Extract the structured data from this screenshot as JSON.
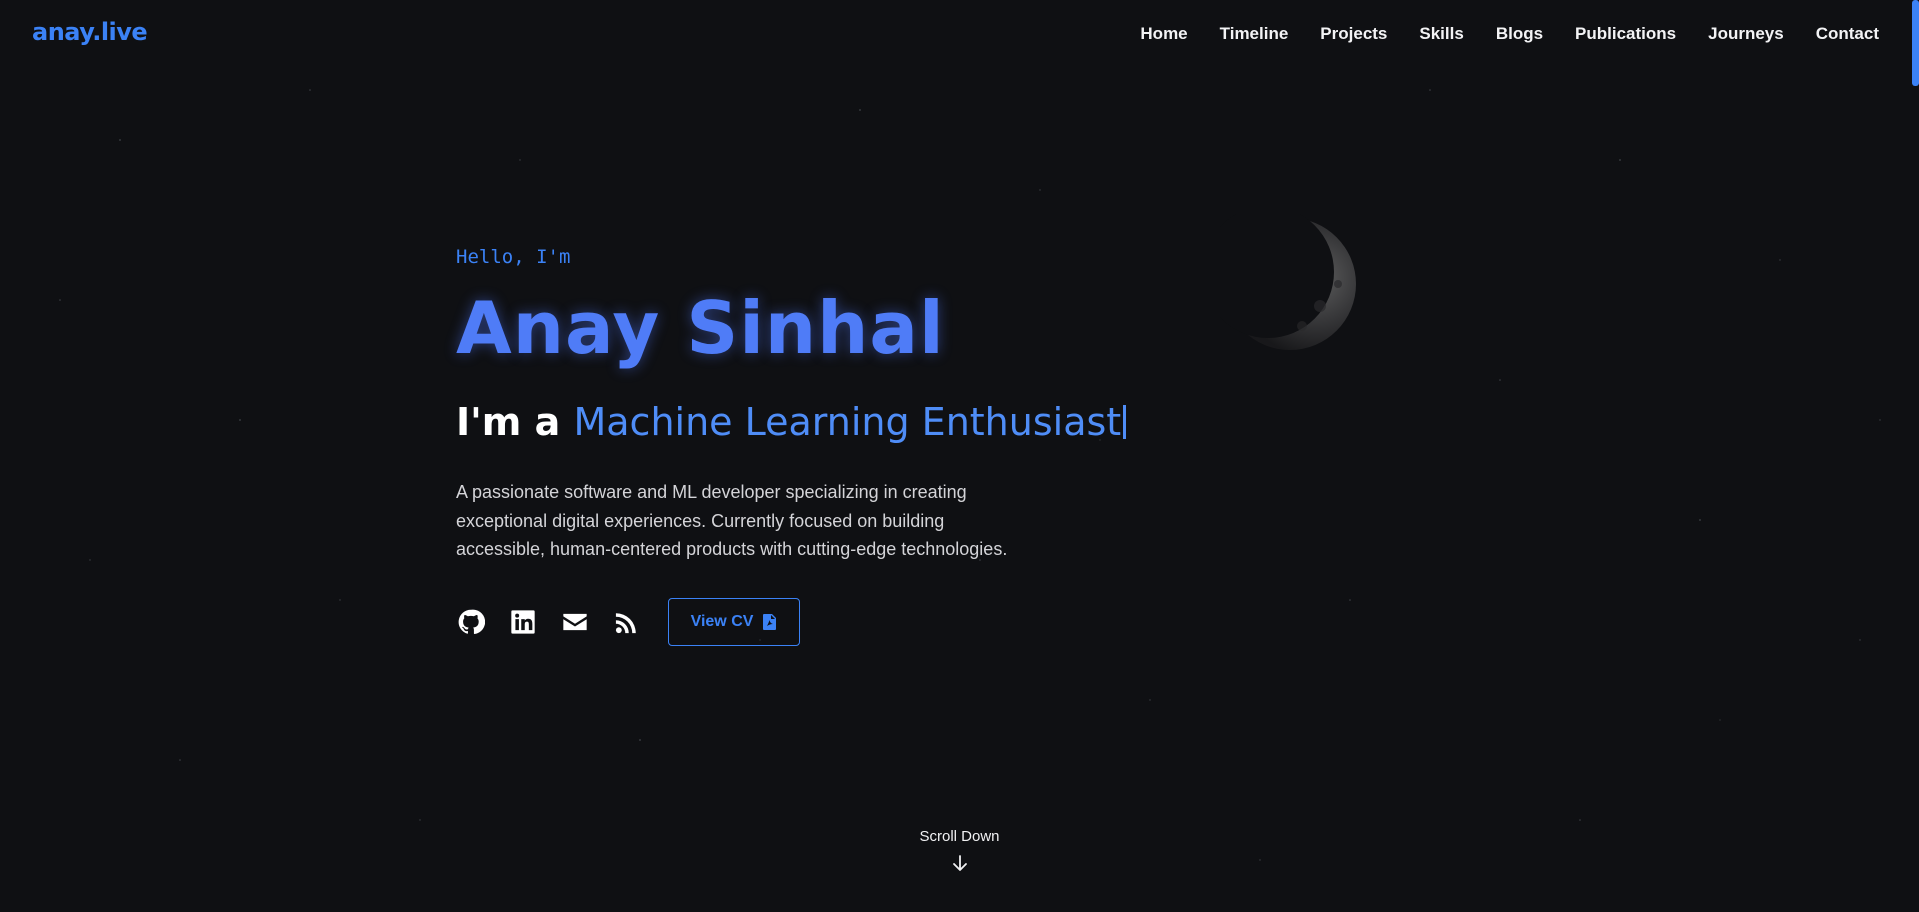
{
  "logo": {
    "text_main": "anay",
    "text_dot": ".",
    "text_tld": "live"
  },
  "nav": {
    "items": [
      "Home",
      "Timeline",
      "Projects",
      "Skills",
      "Blogs",
      "Publications",
      "Journeys",
      "Contact"
    ]
  },
  "hero": {
    "greeting": "Hello, I'm",
    "name": "Anay Sinhal",
    "role_prefix": "I'm a",
    "role_highlight": "Machine Learning Enthusiast",
    "description": "A passionate software and ML developer specializing in creating exceptional digital experiences. Currently focused on building accessible, human-centered products with cutting-edge technologies.",
    "cv_button": "View CV"
  },
  "social_icons": [
    "github-icon",
    "linkedin-icon",
    "mail-icon",
    "rss-icon"
  ],
  "scroll_hint": "Scroll Down",
  "colors": {
    "background": "#0f1013",
    "accent": "#3b82f6",
    "name_gradient": "#4f7cf7",
    "text": "#e8e8ea"
  }
}
